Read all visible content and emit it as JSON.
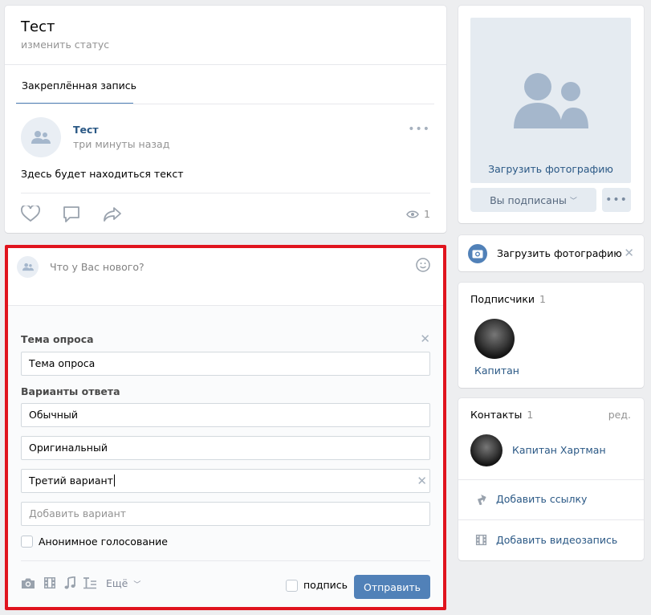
{
  "profile": {
    "name": "Тест",
    "status": "изменить статус",
    "pinned_tab": "Закреплённая запись"
  },
  "post": {
    "author": "Тест",
    "time": "три минуты назад",
    "text": "Здесь будет находиться текст",
    "views": "1"
  },
  "composer": {
    "placeholder": "Что у Вас нового?"
  },
  "poll": {
    "topic_label": "Тема опроса",
    "topic_value": "Тема опроса",
    "options_label": "Варианты ответа",
    "options": [
      "Обычный",
      "Оригинальный",
      "Третий вариант"
    ],
    "add_option_placeholder": "Добавить вариант",
    "anonymous_label": "Анонимное голосование",
    "more_label": "Ещё",
    "signature_label": "подпись",
    "send_label": "Отправить"
  },
  "sidebar": {
    "upload_photo": "Загрузить фотографию",
    "subscribed": "Вы подписаны",
    "upload_banner": "Загрузить фотографию",
    "subscribers_title": "Подписчики",
    "subscribers_count": "1",
    "subscriber_name": "Капитан",
    "contacts_title": "Контакты",
    "contacts_count": "1",
    "edit": "ред.",
    "contact_name": "Капитан Хартман",
    "add_link": "Добавить ссылку",
    "add_video": "Добавить видеозапись"
  },
  "colors": {
    "accent": "#5181b8",
    "link": "#2a5885",
    "highlight_border": "#e0141e",
    "background": "#edeef0"
  }
}
